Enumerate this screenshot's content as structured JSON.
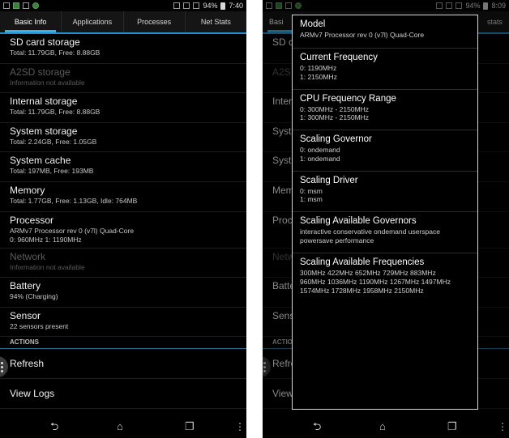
{
  "left": {
    "status": {
      "battery": "94%",
      "time": "7:40"
    },
    "tabs": [
      {
        "label": "Basic Info"
      },
      {
        "label": "Applications"
      },
      {
        "label": "Processes"
      },
      {
        "label": "Net Stats"
      }
    ],
    "items": [
      {
        "title": "SD card storage",
        "subtitle": "Total: 11.79GB, Free: 8.88GB",
        "subtitle2": "",
        "disabled": false
      },
      {
        "title": "A2SD storage",
        "subtitle": "Information not available",
        "subtitle2": "",
        "disabled": true
      },
      {
        "title": "Internal storage",
        "subtitle": "Total: 11.79GB, Free: 8.88GB",
        "subtitle2": "",
        "disabled": false
      },
      {
        "title": "System storage",
        "subtitle": "Total: 2.24GB, Free: 1.05GB",
        "subtitle2": "",
        "disabled": false
      },
      {
        "title": "System cache",
        "subtitle": "Total: 197MB, Free: 193MB",
        "subtitle2": "",
        "disabled": false
      },
      {
        "title": "Memory",
        "subtitle": "Total: 1.77GB, Free: 1.13GB, Idle: 764MB",
        "subtitle2": "",
        "disabled": false
      },
      {
        "title": "Processor",
        "subtitle": "ARMv7 Processor rev 0 (v7l) Quad-Core",
        "subtitle2": "0: 960MHz   1: 1190MHz",
        "disabled": false
      },
      {
        "title": "Network",
        "subtitle": "Information not available",
        "subtitle2": "",
        "disabled": true
      },
      {
        "title": "Battery",
        "subtitle": "94% (Charging)",
        "subtitle2": "",
        "disabled": false
      },
      {
        "title": "Sensor",
        "subtitle": "22 sensors present",
        "subtitle2": "",
        "disabled": false
      }
    ],
    "section_label": "ACTIONS",
    "actions": [
      {
        "label": "Refresh"
      },
      {
        "label": "View Logs"
      }
    ]
  },
  "right": {
    "status": {
      "battery": "94%",
      "time": "8:09"
    },
    "bg_tabs": [
      {
        "label": "Basi"
      },
      {
        "label": "stats"
      }
    ],
    "bg_items": [
      "SD c",
      "A2S",
      "Inter",
      "Syst",
      "Syst",
      "Mem",
      "Proc",
      "Netw",
      "Batte",
      "Sens"
    ],
    "bg_section": "ACTIO",
    "bg_actions": [
      "Refre",
      "View"
    ],
    "dialog": [
      {
        "title": "Model",
        "lines": [
          "ARMv7 Processor rev 0 (v7l) Quad-Core"
        ]
      },
      {
        "title": "Current Frequency",
        "lines": [
          "0: 1190MHz",
          "1: 2150MHz"
        ]
      },
      {
        "title": "CPU Frequency Range",
        "lines": [
          "0: 300MHz - 2150MHz",
          "1: 300MHz - 2150MHz"
        ]
      },
      {
        "title": "Scaling Governor",
        "lines": [
          "0: ondemand",
          "1: ondemand"
        ]
      },
      {
        "title": "Scaling Driver",
        "lines": [
          "0: msm",
          "1: msm"
        ]
      },
      {
        "title": "Scaling Available Governors",
        "lines": [
          "interactive conservative ondemand userspace",
          "powersave performance"
        ]
      },
      {
        "title": "Scaling Available Frequencies",
        "lines": [
          "300MHz  422MHz  652MHz  729MHz  883MHz",
          "960MHz  1036MHz  1190MHz  1267MHz  1497MHz",
          "1574MHz  1728MHz  1958MHz  2150MHz"
        ]
      }
    ]
  },
  "colors": {
    "accent": "#33b5e5",
    "background": "#000000"
  }
}
